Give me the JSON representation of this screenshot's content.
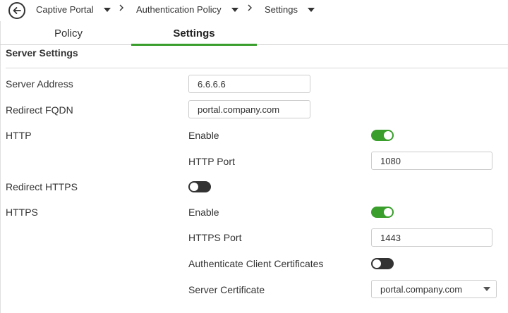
{
  "breadcrumb": {
    "items": [
      "Captive Portal",
      "Authentication Policy",
      "Settings"
    ]
  },
  "tabs": [
    {
      "label": "Policy",
      "active": false
    },
    {
      "label": "Settings",
      "active": true
    }
  ],
  "section": {
    "title": "Server Settings"
  },
  "fields": {
    "server_address": {
      "label": "Server Address",
      "value": "6.6.6.6"
    },
    "redirect_fqdn": {
      "label": "Redirect FQDN",
      "value": "portal.company.com"
    },
    "http": {
      "label": "HTTP",
      "enable_label": "Enable",
      "enabled": true,
      "port_label": "HTTP Port",
      "port": "1080"
    },
    "redirect_https": {
      "label": "Redirect HTTPS",
      "enabled": false
    },
    "https": {
      "label": "HTTPS",
      "enable_label": "Enable",
      "enabled": true,
      "port_label": "HTTPS Port",
      "port": "1443",
      "auth_client_label": "Authenticate Client Certificates",
      "auth_client_enabled": false,
      "server_cert_label": "Server Certificate",
      "server_cert_value": "portal.company.com"
    }
  },
  "colors": {
    "accent": "#3a9e2c",
    "toggle_off": "#333333"
  }
}
